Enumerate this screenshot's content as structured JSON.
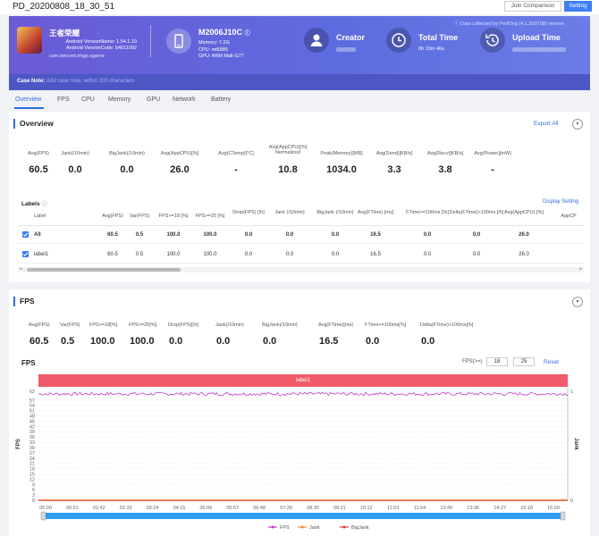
{
  "window": {
    "title": "PD_20200808_18_30_51",
    "join_btn": "Join Comparison",
    "setting_btn": "Setting"
  },
  "banner": {
    "collected": "Data collected by PerfDog (4.1.200708) version",
    "app": {
      "name": "王者荣耀",
      "version": "Android VersionName: 1.54.1.10",
      "code": "Android VersionCode: 54011002",
      "package": "com.tencent.tmgp.sgame"
    },
    "device": {
      "model": "M2006J10C",
      "memory": "Memory: 7.2G",
      "cpu": "CPU: mt6885",
      "gpu": "GPU: ARM Mali-G77"
    },
    "creator_label": "Creator",
    "total_time_label": "Total Time",
    "total_time_value": "0h 10m 46s",
    "upload_label": "Upload Time",
    "case_note_label": "Case Note:",
    "case_note_placeholder": "Add case note, within 200 characters",
    "colors": {
      "gradient_start": "#6b5bd6",
      "gradient_end": "#6c7ce6",
      "note_bar": "#4d57c4"
    }
  },
  "tabs": [
    "Overview",
    "FPS",
    "CPU",
    "Memory",
    "GPU",
    "Network",
    "Battery"
  ],
  "overview": {
    "title": "Overview",
    "export": "Export All",
    "metrics": [
      {
        "label": "Avg(FPS)",
        "value": "60.5"
      },
      {
        "label": "Jank(/10min)",
        "value": "0.0"
      },
      {
        "label": "BigJank(/10min)",
        "value": "0.0"
      },
      {
        "label": "Avg(AppCPU)[%]",
        "value": "26.0"
      },
      {
        "label": "Avg(CTemp)[°C]",
        "value": "-"
      },
      {
        "label": "Avg(AppCPU)[%] Normalized",
        "value": "10.8"
      },
      {
        "label": "Peak(Memory)[MB]",
        "value": "1034.0"
      },
      {
        "label": "Avg(Send)[KB/s]",
        "value": "3.3"
      },
      {
        "label": "Avg(Recv)[KB/s]",
        "value": "3.8"
      },
      {
        "label": "Avg(Power)[mW]",
        "value": "-"
      }
    ],
    "labels_title": "Labels",
    "display_setting": "Display Setting",
    "table": {
      "headers": [
        "Label",
        "Avg(FPS)",
        "Var(FPS)",
        "FPS>=18 [%]",
        "FPS>=25 [%]",
        "Drop(FPS) [/h]",
        "Jank (/10min)",
        "BigJank (/10min)",
        "Avg(FTime) [ms]",
        "FTime>=100ms [%]",
        "Delta(FTime)>100ms [/h]",
        "Avg(AppCPU) [%]",
        "AppCP"
      ],
      "rows": [
        [
          "All",
          "60.5",
          "0.5",
          "100.0",
          "100.0",
          "0.0",
          "0.0",
          "0.0",
          "16.5",
          "0.0",
          "0.0",
          "26.0",
          ""
        ],
        [
          "label1",
          "60.5",
          "0.5",
          "100.0",
          "100.0",
          "0.0",
          "0.0",
          "0.0",
          "16.5",
          "0.0",
          "0.0",
          "26.0",
          ""
        ]
      ]
    }
  },
  "fps": {
    "title": "FPS",
    "metrics": [
      {
        "label": "Avg(FPS)",
        "value": "60.5"
      },
      {
        "label": "Var(FPS)",
        "value": "0.5"
      },
      {
        "label": "FPS>=18[%]",
        "value": "100.0"
      },
      {
        "label": "FPS>=25[%]",
        "value": "100.0"
      },
      {
        "label": "Drop(FPS)[/h]",
        "value": "0.0"
      },
      {
        "label": "Jank(/10min)",
        "value": "0.0"
      },
      {
        "label": "BigJank(/10min)",
        "value": "0.0"
      },
      {
        "label": "Avg(FTime)[ms]",
        "value": "16.5"
      },
      {
        "label": "FTime>=100ms[%]",
        "value": "0.0"
      },
      {
        "label": "Delta(FTime)>100ms[/h]",
        "value": "0.0"
      }
    ],
    "chart_title": "FPS",
    "threshold_label": "FPS(>=)",
    "threshold_1": "18",
    "threshold_2": "25",
    "reset": "Reset",
    "band_label": "label1"
  },
  "chart_data": {
    "type": "line",
    "y_ticks": [
      "0",
      "3",
      "6",
      "9",
      "12",
      "15",
      "18",
      "21",
      "24",
      "27",
      "30",
      "33",
      "36",
      "39",
      "42",
      "45",
      "48",
      "51",
      "54",
      "57",
      "62"
    ],
    "ylim": [
      0,
      64
    ],
    "ylabel": "FPS",
    "y2label": "Jank",
    "y2_ticks": [
      "0",
      "1"
    ],
    "x_ticks": [
      "00:00",
      "00:51",
      "01:42",
      "02:33",
      "03:24",
      "04:15",
      "05:06",
      "05:57",
      "06:48",
      "07:39",
      "08:30",
      "09:21",
      "10:12",
      "11:03",
      "11:54",
      "12:45",
      "13:36",
      "14:27",
      "15:18",
      "16:09"
    ],
    "series": [
      {
        "name": "FPS",
        "color": "#c03cc0",
        "approx_value": 60.5
      },
      {
        "name": "Jank",
        "color": "#f08c3c",
        "approx_value": 0
      },
      {
        "name": "BigJank",
        "color": "#e0403c",
        "approx_value": 0
      }
    ]
  }
}
